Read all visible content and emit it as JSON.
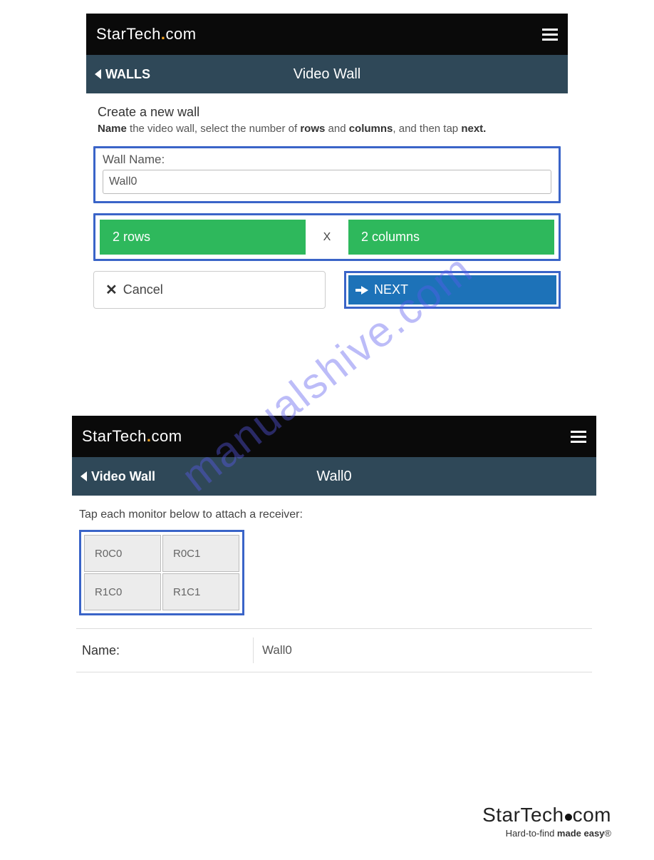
{
  "watermark": "manualshive.com",
  "panel1": {
    "brand_a": "StarTech",
    "brand_b": "com",
    "back_label": "WALLS",
    "title": "Video Wall",
    "heading": "Create a new wall",
    "desc_parts": {
      "p1": "Name",
      "p2": " the video wall, select the number of ",
      "p3": "rows",
      "p4": " and ",
      "p5": "columns",
      "p6": ", and then tap ",
      "p7": "next."
    },
    "name_label": "Wall Name:",
    "name_value": "Wall0",
    "rows_label": "2 rows",
    "x_label": "X",
    "cols_label": "2 columns",
    "cancel_label": "Cancel",
    "next_label": "NEXT"
  },
  "panel2": {
    "brand_a": "StarTech",
    "brand_b": "com",
    "back_label": "Video Wall",
    "title": "Wall0",
    "instructions": "Tap each monitor below to attach a receiver:",
    "cells": {
      "c00": "R0C0",
      "c01": "R0C1",
      "c10": "R1C0",
      "c11": "R1C1"
    },
    "name_label": "Name:",
    "name_value": "Wall0"
  },
  "footer": {
    "logo_a": "StarTech",
    "logo_b": "com",
    "tag_a": "Hard-to-find ",
    "tag_b": "made easy",
    "tag_c": "®"
  }
}
